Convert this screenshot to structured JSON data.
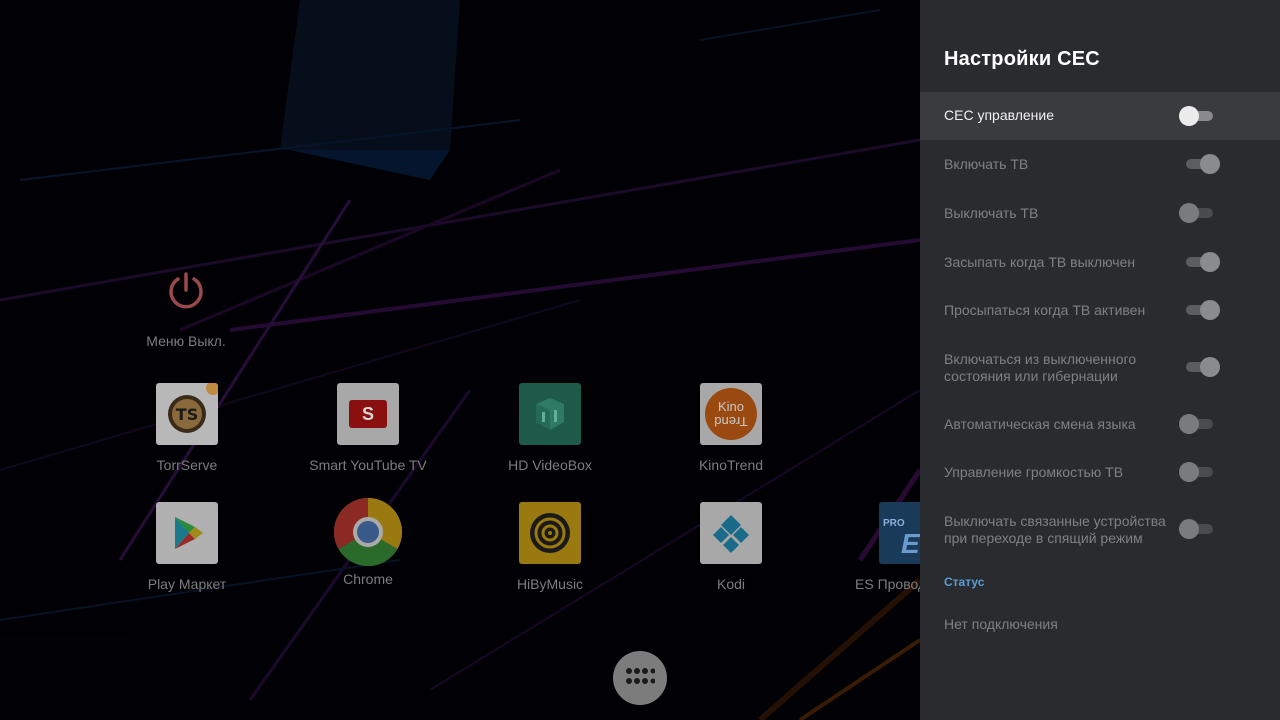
{
  "launcher": {
    "power_menu_label": "Меню Выкл.",
    "apps_row1": [
      {
        "label": "TorrServe",
        "icon": "torrserve-icon"
      },
      {
        "label": "Smart YouTube TV",
        "icon": "smart-youtube-icon"
      },
      {
        "label": "HD VideoBox",
        "icon": "hd-videobox-icon"
      },
      {
        "label": "KinoTrend",
        "icon": "kinotrend-icon"
      }
    ],
    "apps_row2": [
      {
        "label": "Play Маркет",
        "icon": "play-store-icon"
      },
      {
        "label": "Chrome",
        "icon": "chrome-icon"
      },
      {
        "label": "HiByMusic",
        "icon": "hibymusic-icon"
      },
      {
        "label": "Kodi",
        "icon": "kodi-icon"
      },
      {
        "label": "ES Провод",
        "icon": "es-explorer-icon"
      }
    ],
    "youtube_tile_letter": "S",
    "kinotrend_tile_text": "Kino",
    "kinotrend_tile_text2": "Trend",
    "es_tile_badge": "PRO",
    "es_tile_letter": "E",
    "all_apps_icon": "grid-dots-icon"
  },
  "panel": {
    "title": "Настройки CEC",
    "items": [
      {
        "label": "CEC управление",
        "state": "off",
        "focused": true
      },
      {
        "label": "Включать ТВ",
        "state": "on",
        "focused": false
      },
      {
        "label": "Выключать ТВ",
        "state": "off",
        "focused": false
      },
      {
        "label": "Засыпать когда ТВ выключен",
        "state": "on",
        "focused": false
      },
      {
        "label": "Просыпаться когда ТВ активен",
        "state": "on",
        "focused": false
      },
      {
        "label": "Включаться из выключенного состояния или гибернации",
        "state": "on",
        "focused": false
      },
      {
        "label": "Автоматическая смена языка",
        "state": "off",
        "focused": false
      },
      {
        "label": "Управление громкостью ТВ",
        "state": "off",
        "focused": false
      },
      {
        "label": "Выключать связанные устройства при переходе в спящий режим",
        "state": "off",
        "focused": false
      }
    ],
    "status_header": "Статус",
    "status_value": "Нет подключения"
  },
  "colors": {
    "panel_bg": "#2a2b2e",
    "focus_bg": "#3a3b3e",
    "accent": "#5a9bd6"
  }
}
